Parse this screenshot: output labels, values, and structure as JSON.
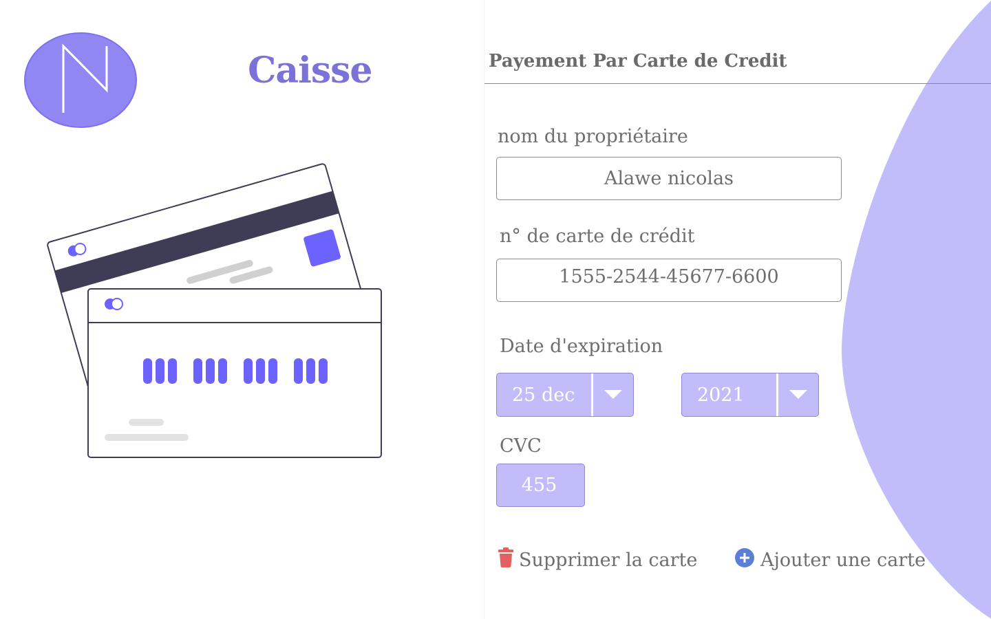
{
  "page": {
    "title": "Caisse",
    "logo_letter": "N"
  },
  "payment": {
    "section_title": "Payement Par Carte de Credit",
    "owner": {
      "label": "nom du propriétaire",
      "value": "Alawe nicolas"
    },
    "card_number": {
      "label": "n° de carte de crédit",
      "value": "1555-2544-45677-6600"
    },
    "expiration": {
      "label": "Date d'expiration",
      "day_month": "25 dec",
      "year": "2021"
    },
    "cvc": {
      "label": "CVC",
      "value": "455"
    }
  },
  "actions": {
    "delete_label": "Supprimer la carte",
    "add_label": "Ajouter une carte"
  },
  "icons": [
    "trash-icon",
    "plus-circle-icon",
    "chevron-down-icon"
  ],
  "colors": {
    "accent": "#7a72d6",
    "card_purple": "#6c63ff",
    "field_fill": "#c1bdfa",
    "blob": "#c1bdfa",
    "delete_red": "#e26060",
    "add_blue": "#5b7fd6"
  }
}
